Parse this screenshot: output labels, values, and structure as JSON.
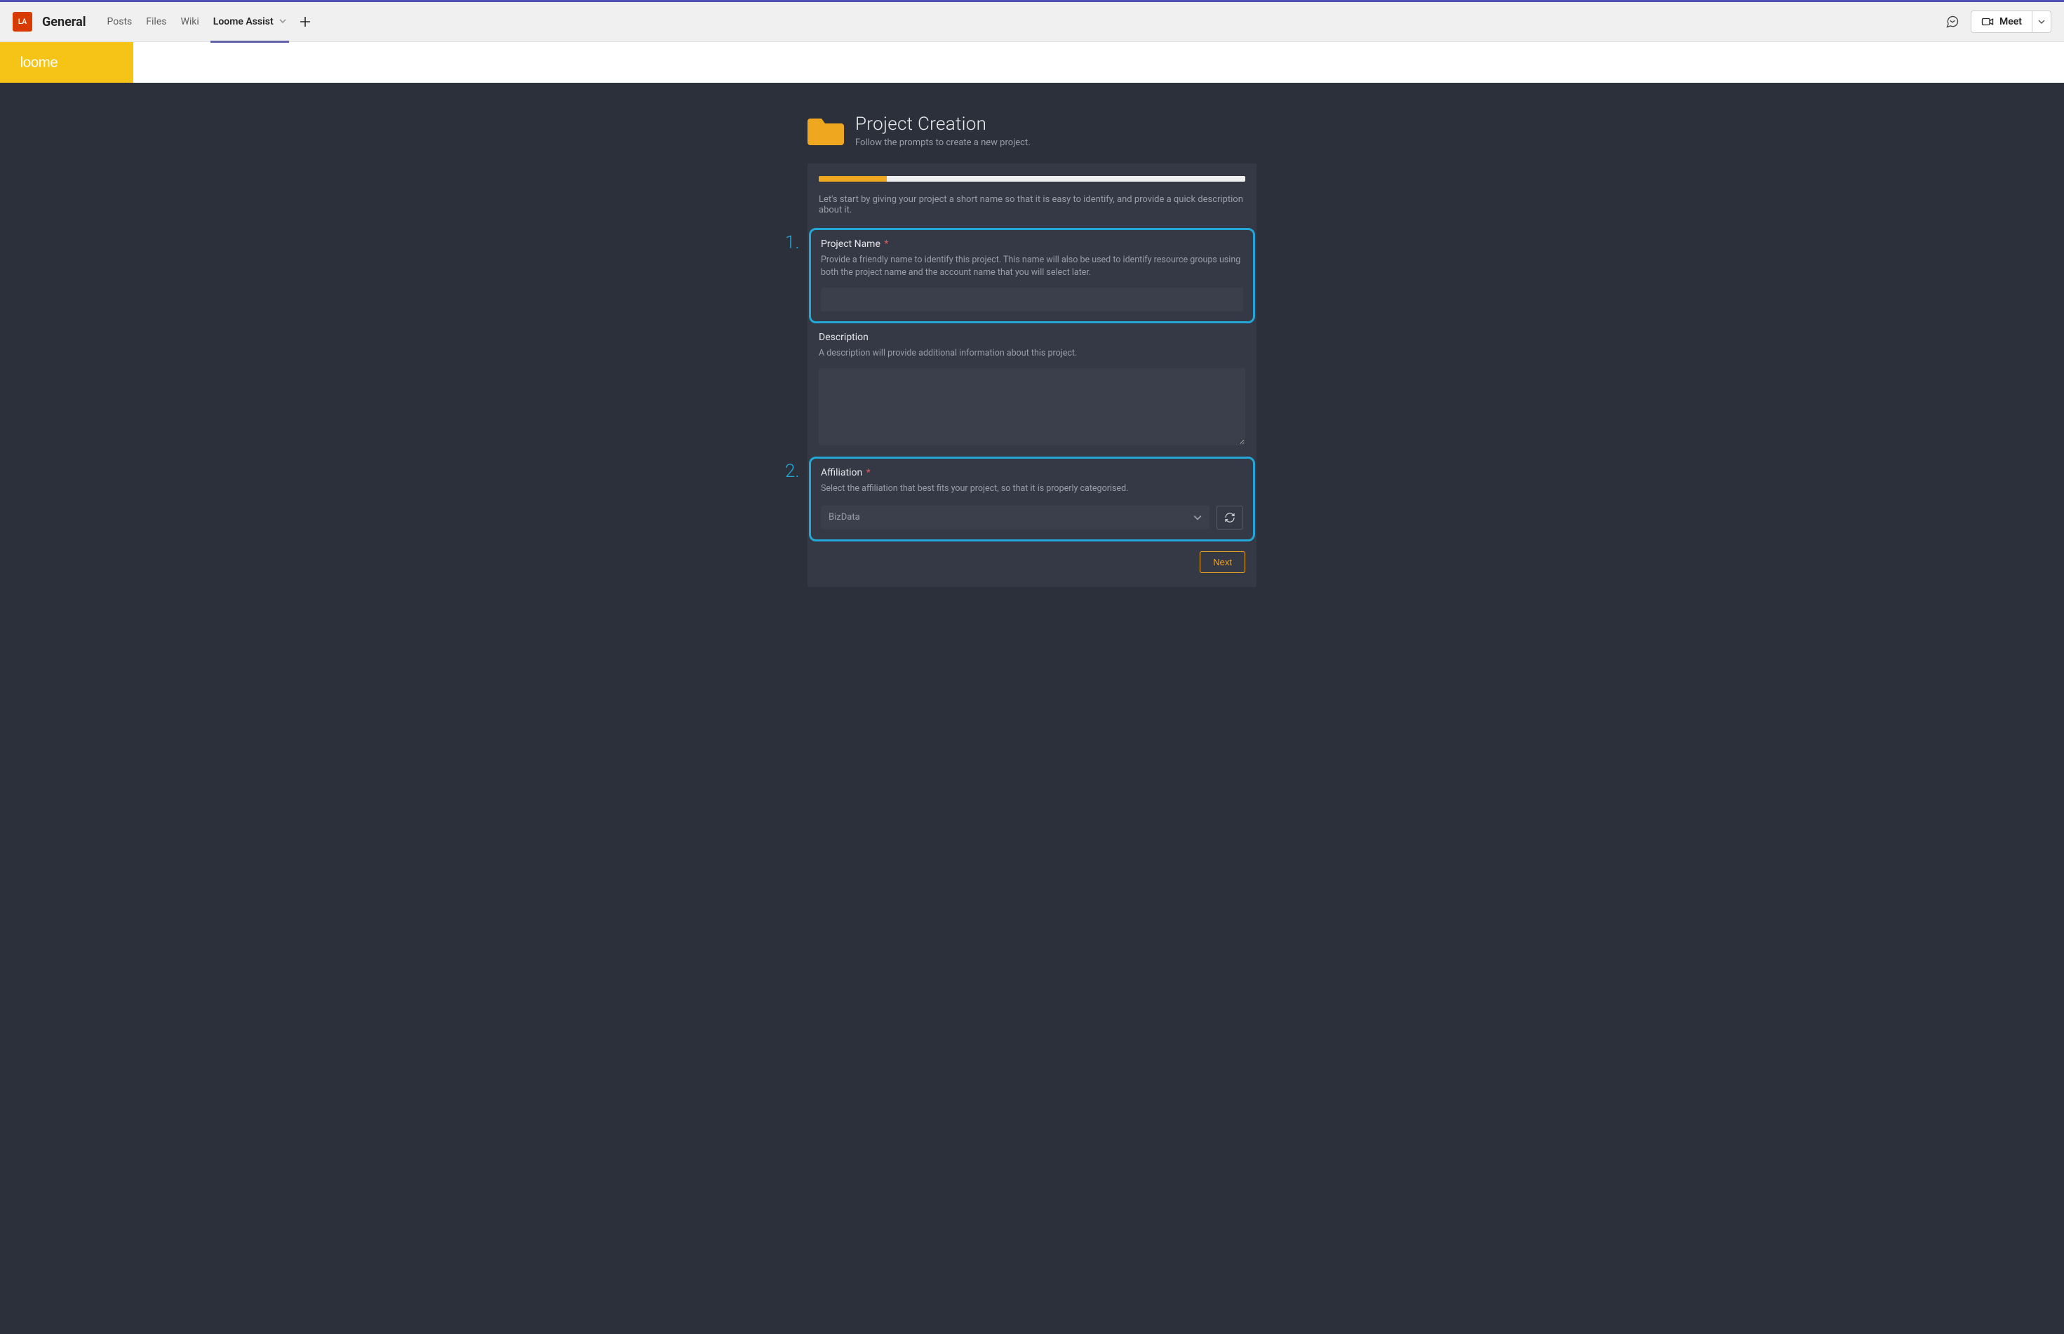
{
  "teams": {
    "avatar_initials": "LA",
    "channel_name": "General",
    "tabs": {
      "posts": "Posts",
      "files": "Files",
      "wiki": "Wiki",
      "loome_assist": "Loome Assist"
    },
    "meet_label": "Meet"
  },
  "loome_brand": "loome",
  "page": {
    "title": "Project Creation",
    "subtitle": "Follow the prompts to create a new project."
  },
  "form": {
    "progress_percent": 16,
    "intro": "Let's start by giving your project a short name so that it is easy to identify, and provide a quick description about it.",
    "callouts": {
      "one": "1.",
      "two": "2."
    },
    "project_name": {
      "label": "Project Name",
      "required_mark": "*",
      "hint": "Provide a friendly name to identify this project. This name will also be used to identify resource groups using both the project name and the account name that you will select later.",
      "value": ""
    },
    "description": {
      "label": "Description",
      "hint": "A description will provide additional information about this project.",
      "value": ""
    },
    "affiliation": {
      "label": "Affiliation",
      "required_mark": "*",
      "hint": "Select the affiliation that best fits your project, so that it is properly categorised.",
      "selected": "BizData"
    },
    "next_label": "Next"
  },
  "colors": {
    "accent_purple": "#6264a7",
    "accent_orange": "#f0a720",
    "highlight_blue": "#23a7d7",
    "dark_bg": "#2c303a",
    "card_bg": "#353945",
    "input_bg": "#3b3f4c",
    "loome_yellow": "#f6c416",
    "avatar_orange": "#d83b01"
  }
}
